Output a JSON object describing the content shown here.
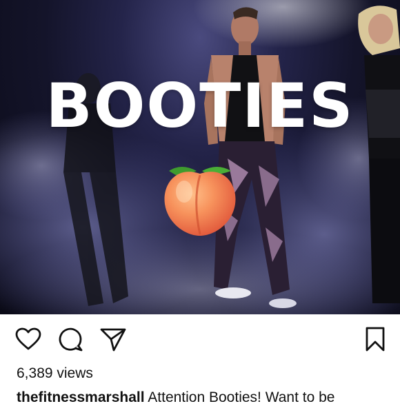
{
  "post": {
    "overlay_title": "BOOTIES",
    "overlay_emoji": "peach",
    "actions": {
      "like_icon": "heart-icon",
      "comment_icon": "comment-bubble-icon",
      "share_icon": "send-paper-plane-icon",
      "save_icon": "bookmark-icon"
    },
    "views_text": "6,389 views",
    "caption": {
      "username": "thefitnessmarshall",
      "text": "Attention Booties! Want to be"
    }
  },
  "colors": {
    "overlay_text": "#ffffff",
    "text": "#111111",
    "peach": "#f2824e",
    "leaf": "#3f9b2e"
  }
}
